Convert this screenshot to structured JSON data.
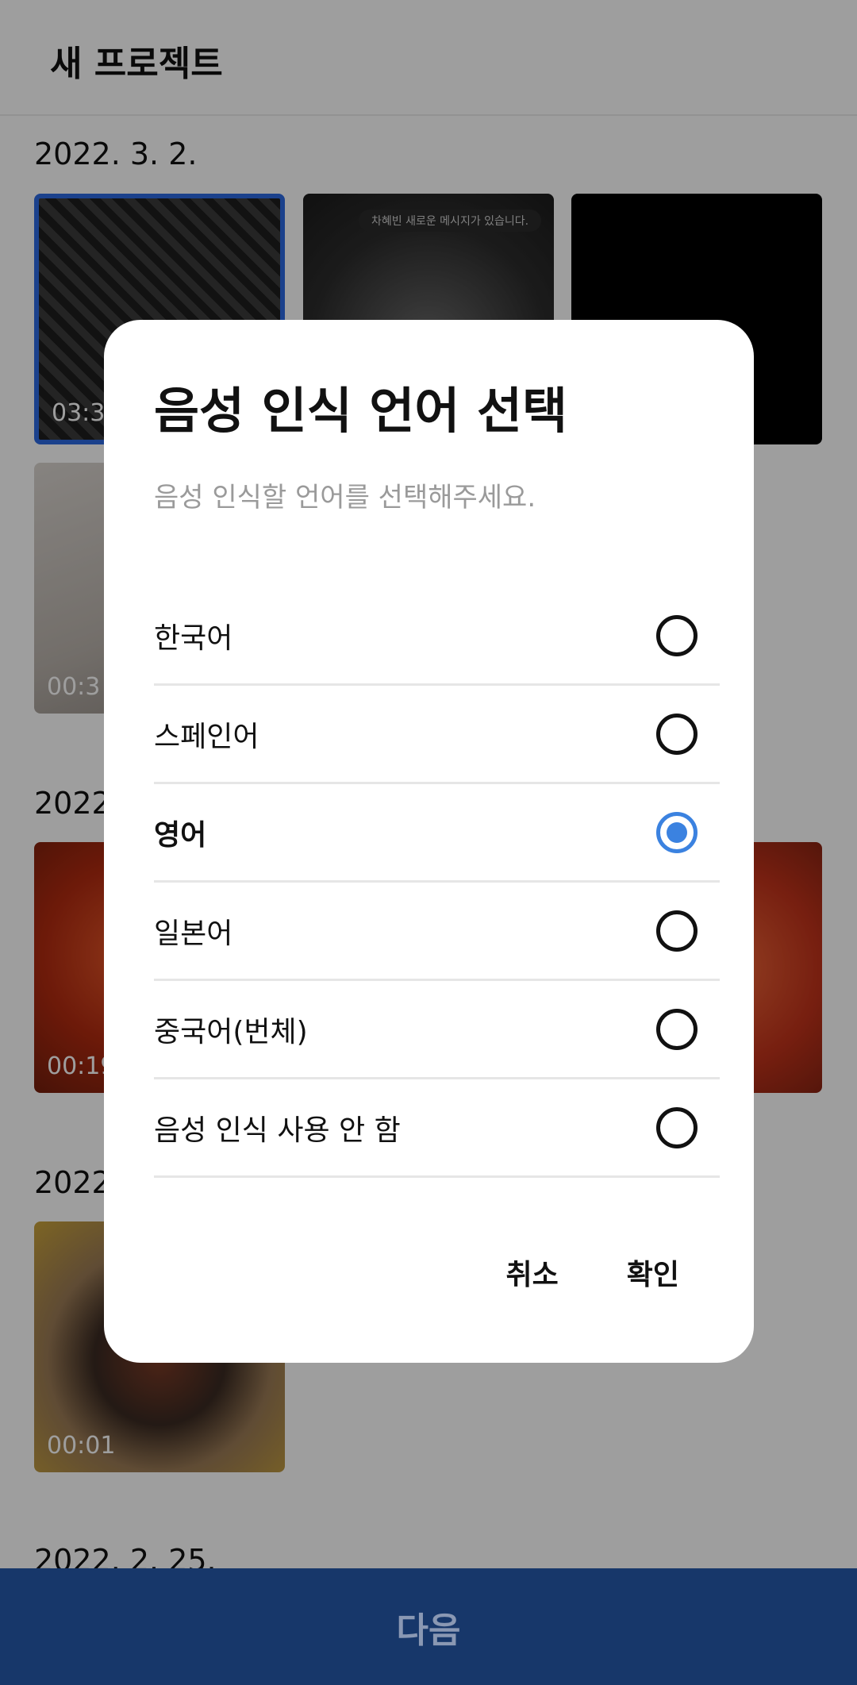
{
  "header": {
    "title": "새 프로젝트"
  },
  "gallery": {
    "dates": [
      "2022. 3. 2.",
      "2022",
      "2022",
      "2022. 2. 25."
    ],
    "thumbnails": [
      {
        "duration": "03:3"
      },
      {
        "notification": "차혜빈  새로운 메시지가 있습니다."
      },
      {
        "duration": ""
      },
      {
        "duration": "00:3"
      },
      {
        "duration": "00:19"
      },
      {
        "duration": "00:01"
      }
    ]
  },
  "dialog": {
    "title": "음성 인식 언어 선택",
    "subtitle": "음성 인식할 언어를 선택해주세요.",
    "options": [
      {
        "label": "한국어",
        "selected": false
      },
      {
        "label": "스페인어",
        "selected": false
      },
      {
        "label": "영어",
        "selected": true
      },
      {
        "label": "일본어",
        "selected": false
      },
      {
        "label": "중국어(번체)",
        "selected": false
      },
      {
        "label": "음성 인식 사용 안 함",
        "selected": false
      }
    ],
    "cancel_label": "취소",
    "confirm_label": "확인"
  },
  "bottom_bar": {
    "next_label": "다음"
  },
  "colors": {
    "accent": "#3b82e0",
    "bottom_bar": "#17376a"
  }
}
